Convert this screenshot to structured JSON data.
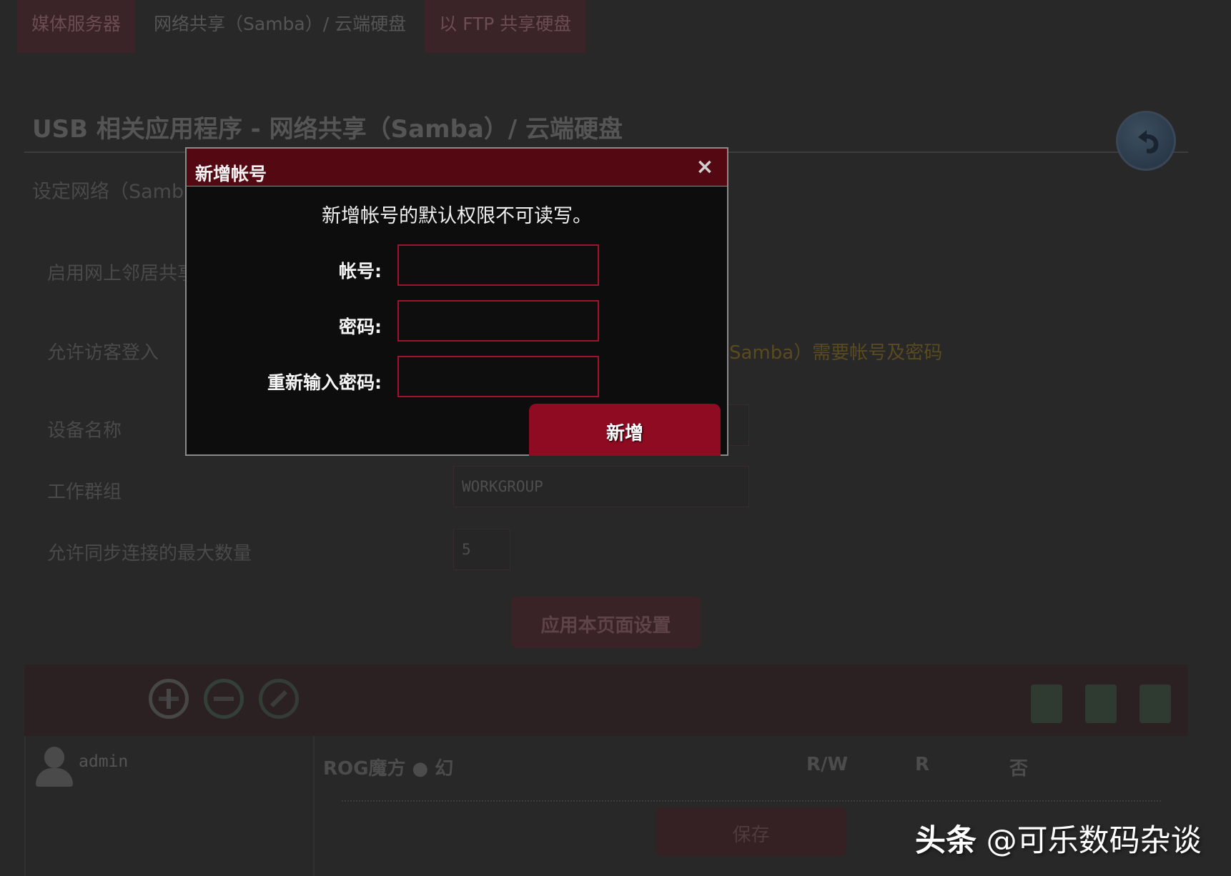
{
  "tabs": [
    {
      "label": "媒体服务器"
    },
    {
      "label": "网络共享（Samba）/ 云端硬盘"
    },
    {
      "label": "以 FTP 共享硬盘"
    }
  ],
  "page": {
    "title": "USB 相关应用程序 - 网络共享（Samba）/ 云端硬盘",
    "description": "设定网络（Samb"
  },
  "settings": {
    "enable_share_label": "启用网上邻居共享",
    "guest_login_label": "允许访客登入",
    "guest_hint": "Samba）需要帐号及密码",
    "device_name_label": "设备名称",
    "workgroup_label": "工作群组",
    "workgroup_value": "WORKGROUP",
    "max_conn_label": "允许同步连接的最大数量",
    "max_conn_value": "5",
    "apply_label": "应用本页面设置"
  },
  "accounts": {
    "user": "admin",
    "share_name": "ROG魔方 ● 幻",
    "col_rw": "R/W",
    "col_r": "R",
    "col_no": "否",
    "save_label": "保存"
  },
  "modal": {
    "title": "新增帐号",
    "close_symbol": "×",
    "notice": "新增帐号的默认权限不可读写。",
    "account_label": "帐号:",
    "password_label": "密码:",
    "confirm_label": "重新输入密码:",
    "account_value": "",
    "password_value": "",
    "confirm_value": "",
    "add_label": "新增"
  },
  "watermark": {
    "brand": "头条",
    "handle": "@可乐数码杂谈"
  }
}
